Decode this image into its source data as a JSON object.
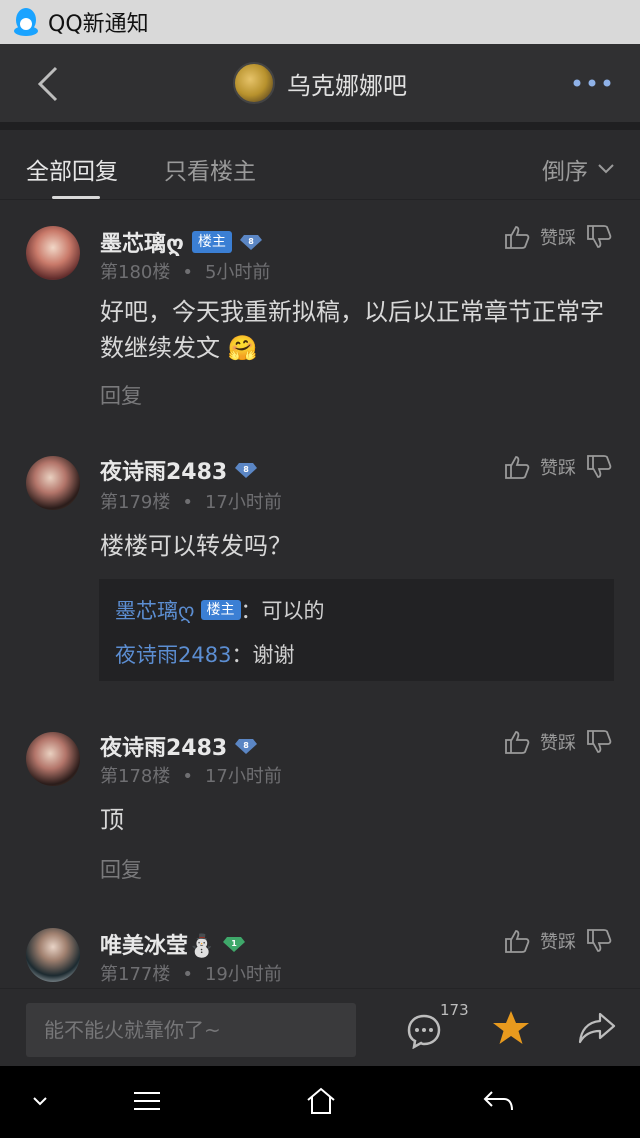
{
  "notification": {
    "title": "QQ新通知"
  },
  "header": {
    "bar_title": "乌克娜娜吧"
  },
  "tabs": {
    "all": "全部回复",
    "host_only": "只看楼主",
    "sort": "倒序"
  },
  "posts": [
    {
      "user": "墨芯璃ღ",
      "host_badge": "楼主",
      "level": "8",
      "floor": "第180楼",
      "time": "5小时前",
      "content": "好吧，今天我重新拟稿，以后以正常章节正常字数继续发文 🤗",
      "reply": "回复",
      "like": "赞踩"
    },
    {
      "user": "夜诗雨2483",
      "level": "8",
      "floor": "第179楼",
      "time": "17小时前",
      "content": "楼楼可以转发吗？",
      "like": "赞踩",
      "quotes": [
        {
          "name": "墨芯璃ღ",
          "badge": "楼主",
          "sep": "：",
          "text": "可以的"
        },
        {
          "name": "夜诗雨2483",
          "sep": "：",
          "text": "谢谢"
        }
      ]
    },
    {
      "user": "夜诗雨2483",
      "level": "8",
      "floor": "第178楼",
      "time": "17小时前",
      "content": "顶",
      "reply": "回复",
      "like": "赞踩"
    },
    {
      "user": "唯美冰莹⛄",
      "level": "1",
      "floor": "第177楼",
      "time": "19小时前",
      "like": "赞踩"
    }
  ],
  "composer": {
    "placeholder": "能不能火就靠你了~",
    "comment_count": "173"
  },
  "colors": {
    "accent_blue": "#3b7fd4",
    "star": "#e89a1e",
    "background": "#2b2b2d"
  }
}
